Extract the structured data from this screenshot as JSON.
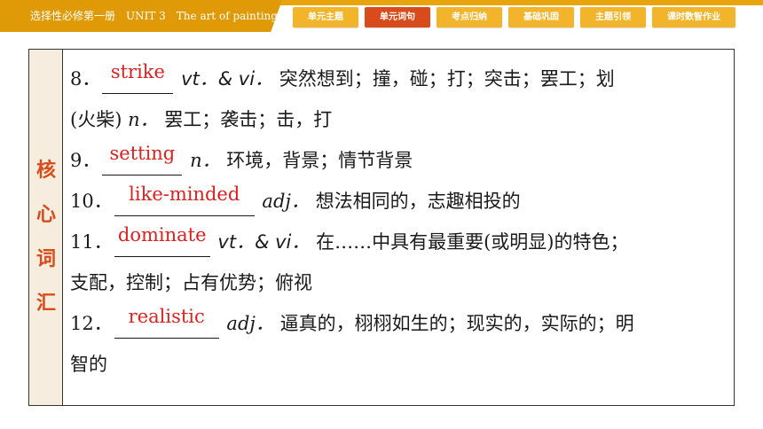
{
  "header": {
    "title": "选择性必修第一册　UNIT 3　The art of painting",
    "tabs": [
      {
        "label": "单元主题",
        "active": false
      },
      {
        "label": "单元词句",
        "active": true
      },
      {
        "label": "考点归纳",
        "active": false
      },
      {
        "label": "基础巩固",
        "active": false
      },
      {
        "label": "主题引领",
        "active": false
      },
      {
        "label": "课时数智作业",
        "active": false
      }
    ]
  },
  "side_label": [
    "核",
    "心",
    "词",
    "汇"
  ],
  "entries": [
    {
      "num": "8．",
      "answer": "strike",
      "pos": "vt．& vi．",
      "def": "突然想到；撞，碰；打；突击；罢工；划",
      "cont_pos_prefix": "(火柴)",
      "cont_pos": "n．",
      "cont_def": "罢工；袭击；击，打"
    },
    {
      "num": "9．",
      "answer": "setting",
      "pos": "n．",
      "def": "环境，背景；情节背景"
    },
    {
      "num": "10．",
      "answer": "like-minded",
      "pos": "adj．",
      "def": "想法相同的，志趣相投的"
    },
    {
      "num": "11．",
      "answer": "dominate",
      "pos": "vt．& vi．",
      "def": "在……中具有最重要(或明显)的特色；",
      "cont_def": "支配，控制；占有优势；俯视"
    },
    {
      "num": "12．",
      "answer": "realistic",
      "pos": "adj．",
      "def": "逼真的，栩栩如生的；现实的，实际的；明",
      "cont_def": "智的"
    }
  ],
  "colors": {
    "accent": "#e19a07",
    "active_tab": "#d84b1a",
    "answer": "#e01f1f",
    "side_bg": "#f6eddf"
  }
}
